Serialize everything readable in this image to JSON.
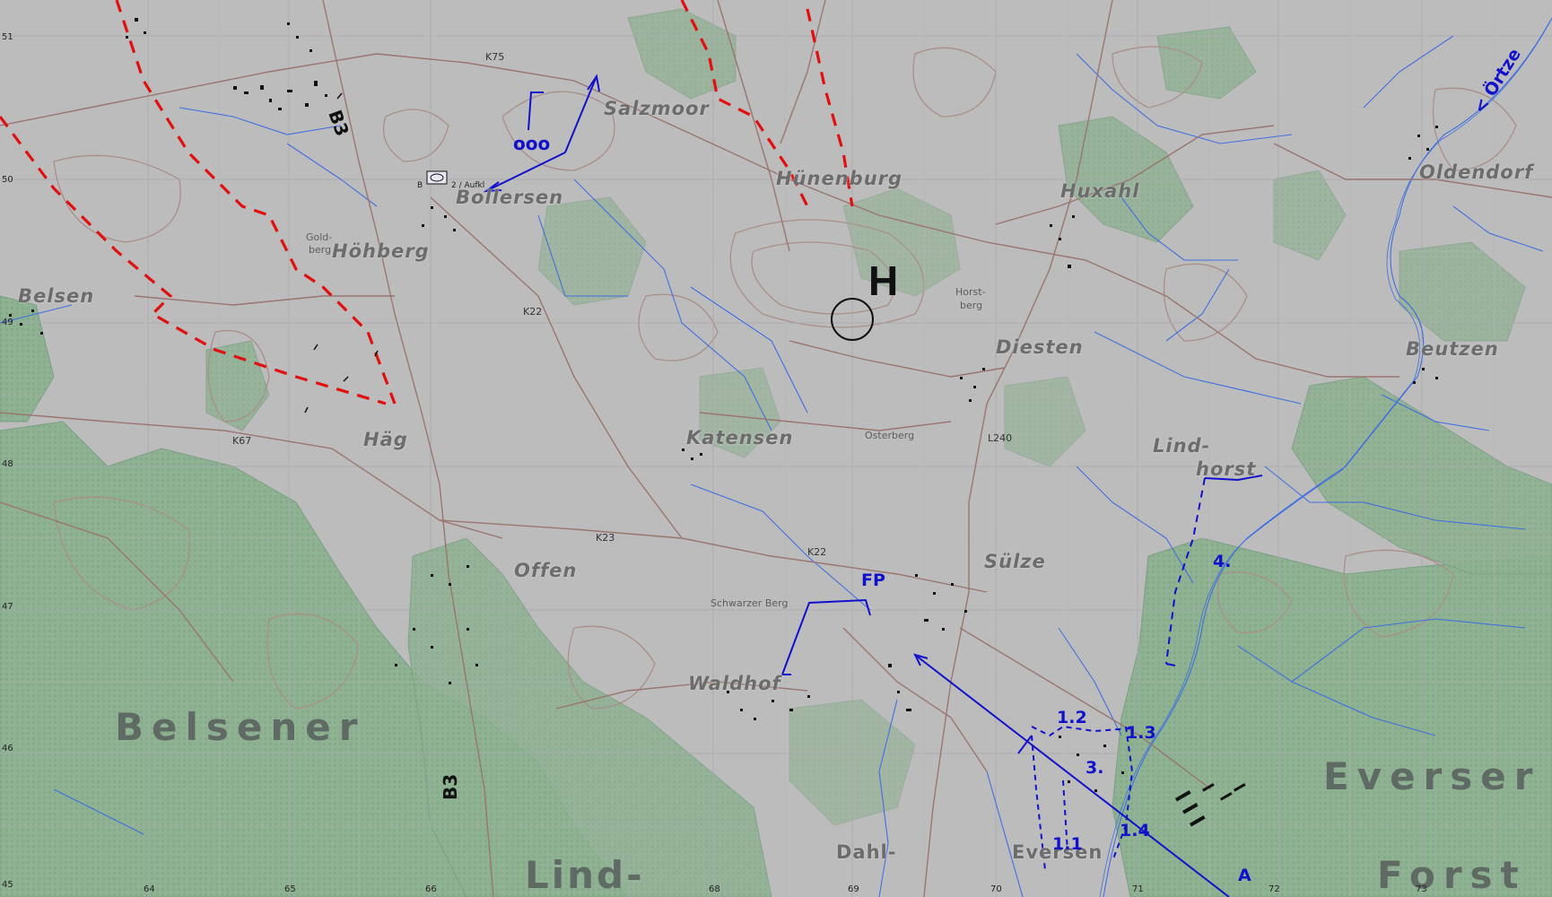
{
  "colors": {
    "background": "#bcbcbc",
    "forest": "#8fb292",
    "forest_dark": "#7aa381",
    "contour": "#a98f8a",
    "road": "#9a7570",
    "water": "#3f6fe0",
    "tactical_blue": "#1111cc",
    "boundary_red": "#e01010",
    "settlement": "#111111"
  },
  "places": {
    "salzmoor": "Salzmoor",
    "huenenburg": "Hünenburg",
    "huxahl": "Huxahl",
    "oldendorf": "Oldendorf",
    "bollersen": "Bollersen",
    "hoehberg": "Höhberg",
    "belsen": "Belsen",
    "diesten": "Diesten",
    "beutzen": "Beutzen",
    "haeg": "Häg",
    "katensen": "Katensen",
    "lindhorst_1": "Lind-",
    "lindhorst_2": "horst",
    "offen": "Offen",
    "suelze": "Sülze",
    "waldhof": "Waldhof",
    "dahl": "Dahl-",
    "eversen": "Eversen"
  },
  "regions": {
    "belsener": "Belsener",
    "lind": "Lind-",
    "everser": "Everser",
    "forst": "Forst"
  },
  "hills": {
    "goldberg_1": "Gold-",
    "goldberg_2": "berg",
    "horstberg_1": "Horst-",
    "horstberg_2": "berg",
    "osterberg": "Osterberg",
    "schwarzer_berg": "Schwarzer Berg"
  },
  "roads": {
    "k75": "K75",
    "k22_north": "K22",
    "k67": "K67",
    "l240": "L240",
    "k23": "K23",
    "k22_south": "K22",
    "b3_north": "B3",
    "b3_south": "B3"
  },
  "river": "< Örtze",
  "grid_labels": {
    "y51": "51",
    "y50": "50",
    "y49": "49",
    "y48": "48",
    "y47": "47",
    "y46": "46",
    "y45": "45",
    "x64": "64",
    "x65": "65",
    "x66": "66",
    "x68": "68",
    "x69": "69",
    "x70": "70",
    "x71": "71",
    "x72": "72",
    "x73": "73"
  },
  "tactical": {
    "objective_marker": "H",
    "unit_symbol": "ooo",
    "unit_label": "2 / Aufkl",
    "unit_label_prefix": "B",
    "fp": "FP",
    "sector_1_1": "1.1",
    "sector_1_2": "1.2",
    "sector_1_3": "1.3",
    "sector_1_4": "1.4",
    "sector_3": "3.",
    "sector_4": "4.",
    "axis_a": "A"
  }
}
